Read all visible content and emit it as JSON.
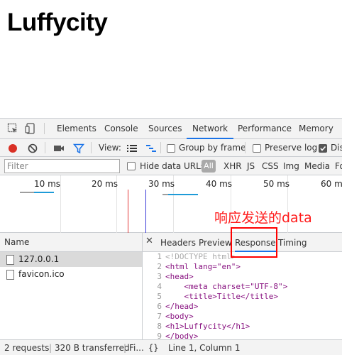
{
  "page": {
    "title": "Luffycity"
  },
  "devtools": {
    "tabs": [
      "Elements",
      "Console",
      "Sources",
      "Network",
      "Performance",
      "Memory"
    ],
    "active_tab": "Network",
    "toolbar": {
      "view_label": "View:",
      "group_by_frame": "Group by frame",
      "preserve_log": "Preserve log",
      "disable_cache": "Dis"
    },
    "filter": {
      "placeholder": "Filter",
      "hide_data_urls": "Hide data URLs",
      "all": "All",
      "types": [
        "XHR",
        "JS",
        "CSS",
        "Img",
        "Media",
        "Fo"
      ]
    },
    "timeline_ticks": [
      "10 ms",
      "20 ms",
      "30 ms",
      "40 ms",
      "50 ms",
      "60 ms"
    ],
    "requests": {
      "header": "Name",
      "rows": [
        "127.0.0.1",
        "favicon.ico"
      ]
    },
    "detail_tabs": [
      "Headers",
      "Preview",
      "Response",
      "Timing"
    ],
    "active_detail_tab": "Response",
    "response_lines": [
      "<!DOCTYPE html>",
      "<html lang=\"en\">",
      "<head>",
      "    <meta charset=\"UTF-8\">",
      "    <title>Title</title>",
      "</head>",
      "<body>",
      "<h1>Luffycity</h1>",
      "</body>"
    ],
    "status": {
      "requests": "2 requests",
      "transferred": "320 B transferred",
      "finish": "Fi...",
      "format_icon": "{}",
      "cursor": "Line 1, Column 1"
    }
  },
  "annotation": {
    "text": "响应发送的data"
  },
  "colors": {
    "accent": "#1a73e8",
    "annotation": "#ff1a1a",
    "record": "#d93025"
  }
}
